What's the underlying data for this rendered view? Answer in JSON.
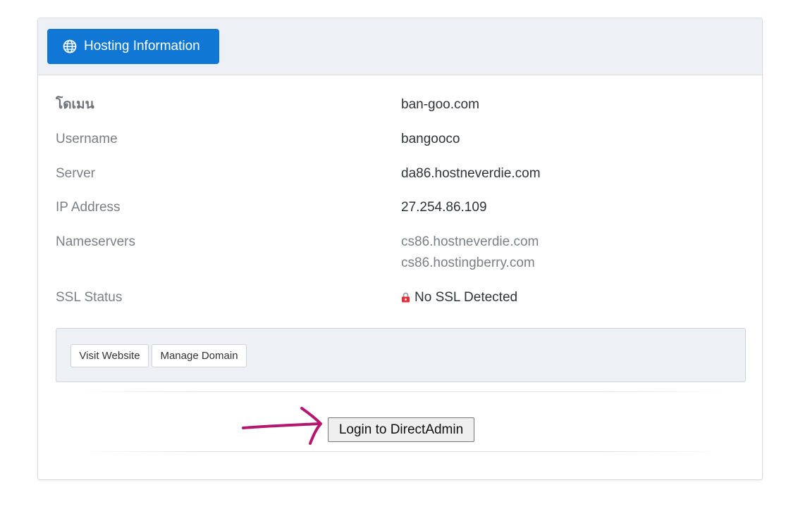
{
  "header": {
    "button_label": "Hosting Information",
    "button_color": "#1077d4",
    "icon": "globe-icon"
  },
  "details": [
    {
      "label": "โดเมน",
      "value": "ban-goo.com"
    },
    {
      "label": "Username",
      "value": "bangooco"
    },
    {
      "label": "Server",
      "value": "da86.hostneverdie.com"
    },
    {
      "label": "IP Address",
      "value": "27.254.86.109"
    },
    {
      "label": "Nameservers",
      "values": [
        "cs86.hostneverdie.com",
        "cs86.hostingberry.com"
      ]
    },
    {
      "label": "SSL Status",
      "value": "No SSL Detected",
      "icon": "lock-icon"
    }
  ],
  "actions": {
    "visit_website": "Visit Website",
    "manage_domain": "Manage Domain"
  },
  "login": {
    "label": "Login to DirectAdmin"
  },
  "annotation": {
    "arrow_color": "#b5176f"
  }
}
